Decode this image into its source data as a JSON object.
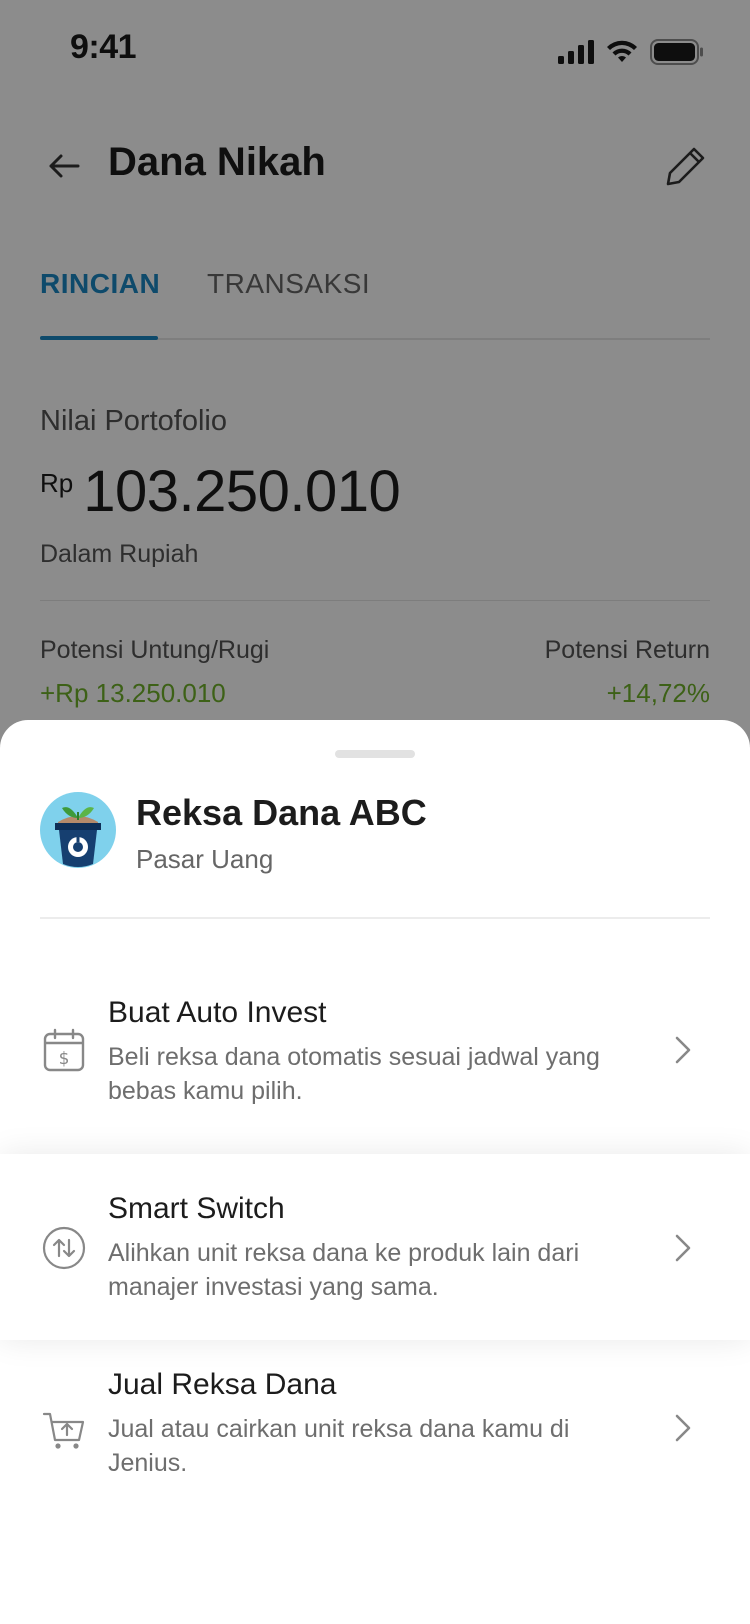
{
  "status_bar": {
    "time": "9:41"
  },
  "header": {
    "title": "Dana Nikah",
    "back_icon": "arrow-left-icon",
    "edit_icon": "pencil-icon"
  },
  "tabs": [
    {
      "label": "RINCIAN",
      "active": true
    },
    {
      "label": "TRANSAKSI",
      "active": false
    }
  ],
  "portfolio": {
    "label": "Nilai Portofolio",
    "currency": "Rp",
    "amount": "103.250.010",
    "note": "Dalam Rupiah",
    "gain_label": "Potensi Untung/Rugi",
    "gain_value": "+Rp 13.250.010",
    "return_label": "Potensi Return",
    "return_value": "+14,72%"
  },
  "sheet": {
    "fund_name": "Reksa Dana ABC",
    "fund_type": "Pasar Uang",
    "options": [
      {
        "title": "Buat Auto Invest",
        "desc": "Beli reksa dana otomatis sesuai jadwal yang bebas kamu pilih.",
        "icon": "calendar-dollar-icon"
      },
      {
        "title": "Smart Switch",
        "desc": "Alihkan unit reksa dana ke produk lain dari manajer investasi yang sama.",
        "icon": "switch-arrows-icon"
      },
      {
        "title": "Jual Reksa Dana",
        "desc": "Jual atau cairkan unit reksa dana kamu di Jenius.",
        "icon": "cart-upload-icon"
      }
    ]
  },
  "colors": {
    "accent": "#1a88c4",
    "positive": "#6fb12b",
    "overlay": "rgba(0,0,0,0.45)"
  }
}
